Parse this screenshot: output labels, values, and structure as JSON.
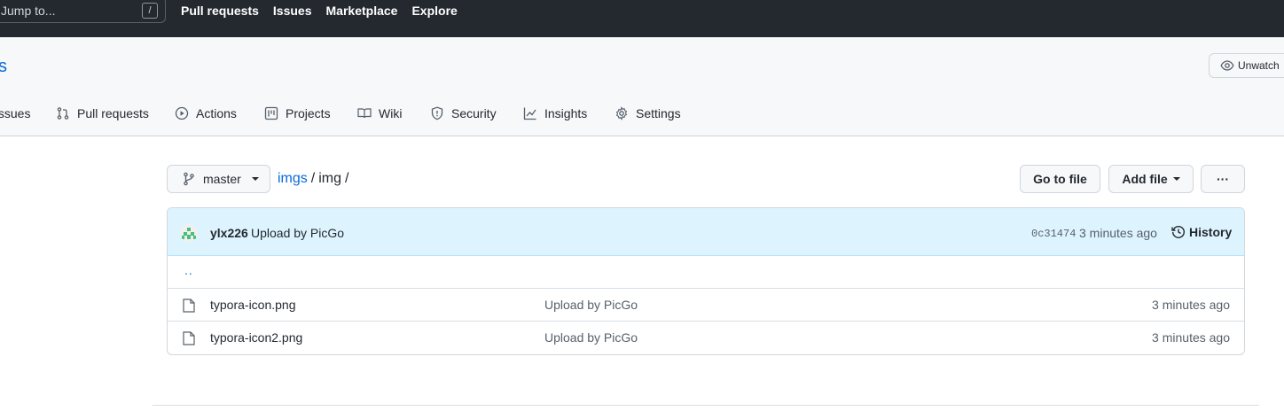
{
  "header": {
    "search_placeholder": "Jump to...",
    "search_shortcut": "/",
    "nav": [
      "Pull requests",
      "Issues",
      "Marketplace",
      "Explore"
    ]
  },
  "repo": {
    "name_fragment": "s",
    "unwatch_label": "Unwatch"
  },
  "tabs": [
    {
      "label": "Issues",
      "icon": "issue-icon"
    },
    {
      "label": "Pull requests",
      "icon": "pull-request-icon"
    },
    {
      "label": "Actions",
      "icon": "play-icon"
    },
    {
      "label": "Projects",
      "icon": "project-icon"
    },
    {
      "label": "Wiki",
      "icon": "book-icon"
    },
    {
      "label": "Security",
      "icon": "shield-icon"
    },
    {
      "label": "Insights",
      "icon": "graph-icon"
    },
    {
      "label": "Settings",
      "icon": "gear-icon"
    }
  ],
  "files_toolbar": {
    "branch": "master",
    "path": [
      "imgs",
      "img"
    ],
    "go_to_file": "Go to file",
    "add_file": "Add file",
    "more": "···"
  },
  "latest_commit": {
    "user": "ylx226",
    "message": "Upload by PicGo",
    "sha": "0c31474",
    "time": "3 minutes ago",
    "history_label": "History"
  },
  "parent_dir": "..",
  "files": [
    {
      "name": "typora-icon.png",
      "message": "Upload by PicGo",
      "time": "3 minutes ago"
    },
    {
      "name": "typora-icon2.png",
      "message": "Upload by PicGo",
      "time": "3 minutes ago"
    }
  ]
}
